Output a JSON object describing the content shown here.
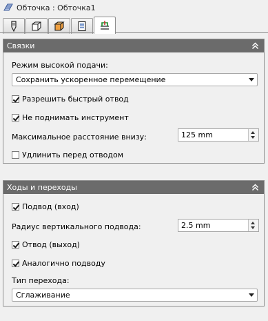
{
  "window": {
    "title": "Обточка : Обточка1",
    "icon": "operation-icon"
  },
  "tabs": [
    {
      "icon": "tool-icon"
    },
    {
      "icon": "stock-box-icon"
    },
    {
      "icon": "feature-box-icon"
    },
    {
      "icon": "parameters-list-icon"
    },
    {
      "icon": "links-icon",
      "active": true
    }
  ],
  "links_panel": {
    "title": "Связки",
    "high_feed_mode_label": "Режим высокой подачи:",
    "high_feed_mode_value": "Сохранить ускоренное перемещение",
    "allow_rapid_retract": {
      "label": "Разрешить быстрый отвод",
      "checked": true
    },
    "keep_tool_down": {
      "label": "Не поднимать инструмент",
      "checked": true
    },
    "max_stay_down_label": "Максимальное расстояние внизу:",
    "max_stay_down_value": "125 mm",
    "lengthen_before_retract": {
      "label": "Удлинить перед отводом",
      "checked": false
    }
  },
  "passes_panel": {
    "title": "Ходы и переходы",
    "lead_in": {
      "label": "Подвод (вход)",
      "checked": true
    },
    "vertical_lead_in_radius_label": "Радиус вертикального подвода:",
    "vertical_lead_in_radius_value": "2.5 mm",
    "lead_out": {
      "label": "Отвод (выход)",
      "checked": true
    },
    "same_as_lead_in": {
      "label": "Аналогично подводу",
      "checked": true
    },
    "transition_type_label": "Тип перехода:",
    "transition_type_value": "Сглаживание"
  }
}
